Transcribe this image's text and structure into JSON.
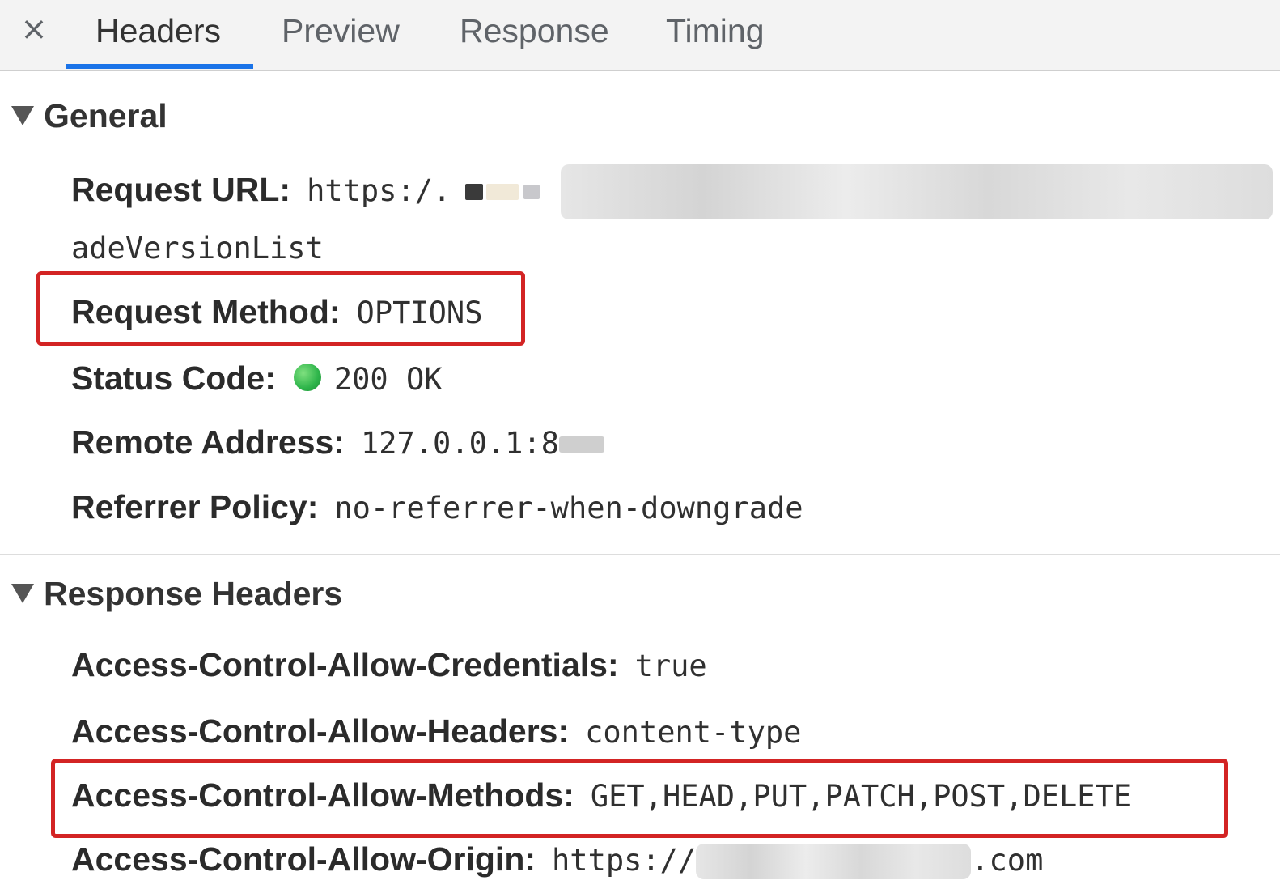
{
  "tabs": {
    "close_icon": "×",
    "items": [
      "Headers",
      "Preview",
      "Response",
      "Timing"
    ],
    "active": "Headers"
  },
  "general": {
    "title": "General",
    "request_url": {
      "key": "Request URL:",
      "value": "https:/.",
      "continuation": "adeVersionList"
    },
    "request_method": {
      "key": "Request Method:",
      "value": "OPTIONS"
    },
    "status_code": {
      "key": "Status Code:",
      "value": "200 OK",
      "status_color": "#2db44a"
    },
    "remote_address": {
      "key": "Remote Address:",
      "value": "127.0.0.1:8"
    },
    "referrer_policy": {
      "key": "Referrer Policy:",
      "value": "no-referrer-when-downgrade"
    }
  },
  "response_headers": {
    "title": "Response Headers",
    "credentials": {
      "key": "Access-Control-Allow-Credentials:",
      "value": "true"
    },
    "headers": {
      "key": "Access-Control-Allow-Headers:",
      "value": "content-type"
    },
    "methods": {
      "key": "Access-Control-Allow-Methods:",
      "value": "GET,HEAD,PUT,PATCH,POST,DELETE"
    },
    "origin": {
      "key": "Access-Control-Allow-Origin:",
      "value_prefix": "https://",
      "value_suffix": ".com"
    }
  },
  "colors": {
    "highlight_border": "#d32424",
    "active_tab_underline": "#1a73e8"
  }
}
